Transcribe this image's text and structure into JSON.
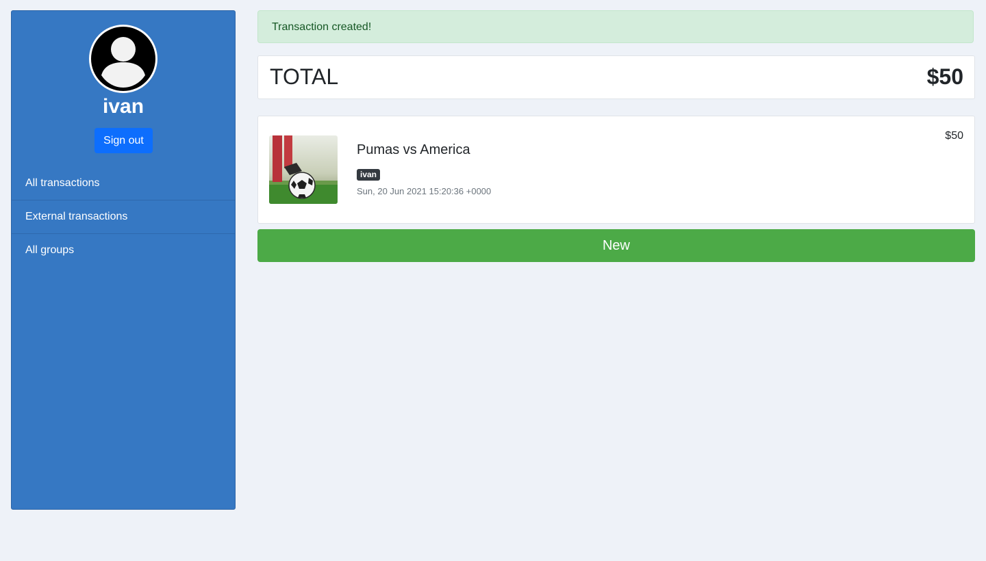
{
  "sidebar": {
    "username": "ivan",
    "signout_label": "Sign out",
    "items": [
      {
        "label": "All transactions"
      },
      {
        "label": "External transactions"
      },
      {
        "label": "All groups"
      }
    ]
  },
  "alert": {
    "message": "Transaction created!"
  },
  "total": {
    "label": "TOTAL",
    "value": "$50"
  },
  "transactions": [
    {
      "title": "Pumas vs America",
      "author": "ivan",
      "date": "Sun, 20 Jun 2021 15:20:36 +0000",
      "amount": "$50",
      "icon": "soccer-image"
    }
  ],
  "actions": {
    "new_label": "New"
  },
  "colors": {
    "sidebar": "#3678c3",
    "primary_button": "#0d6efd",
    "new_button": "#4caa47",
    "alert_bg": "#d4eddc",
    "page_bg": "#eef2f8"
  }
}
